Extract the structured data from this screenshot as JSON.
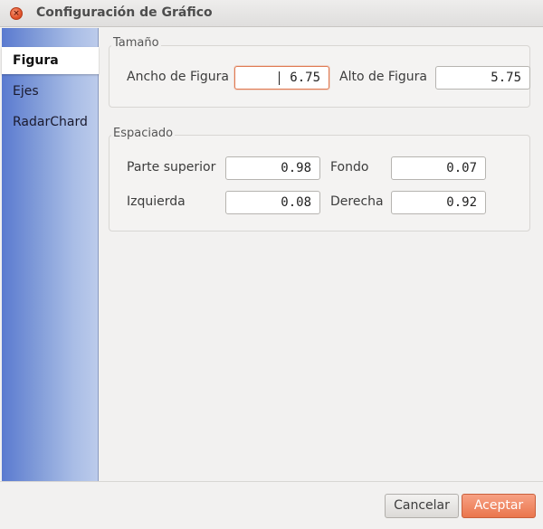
{
  "window": {
    "title": "Configuración de Gráfico",
    "close_glyph": "×"
  },
  "sidebar": {
    "items": [
      {
        "label": "Figura",
        "active": true
      },
      {
        "label": "Ejes",
        "active": false
      },
      {
        "label": "RadarChard",
        "active": false
      }
    ]
  },
  "size_group": {
    "legend": "Tamaño",
    "width_label": "Ancho de Figura",
    "width_value": "6.75",
    "height_label": "Alto de Figura",
    "height_value": "5.75"
  },
  "spacing_group": {
    "legend": "Espaciado",
    "top_label": "Parte superior",
    "top_value": "0.98",
    "bottom_label": "Fondo",
    "bottom_value": "0.07",
    "left_label": "Izquierda",
    "left_value": "0.08",
    "right_label": "Derecha",
    "right_value": "0.92"
  },
  "buttons": {
    "cancel_label": "Cancelar",
    "accept_label": "Aceptar"
  }
}
